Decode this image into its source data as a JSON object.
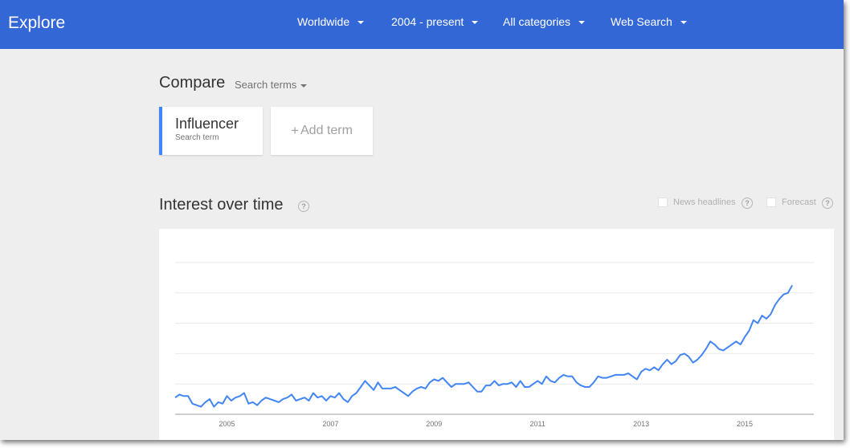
{
  "header": {
    "title": "Explore",
    "filters": [
      {
        "label": "Worldwide"
      },
      {
        "label": "2004 - present"
      },
      {
        "label": "All categories"
      },
      {
        "label": "Web Search"
      }
    ]
  },
  "compare": {
    "title": "Compare",
    "mode_label": "Search terms",
    "terms": [
      {
        "name": "Influencer",
        "type": "Search term",
        "color": "#4285f4"
      }
    ],
    "add_term_label": "Add term",
    "add_term_prefix": "+"
  },
  "interest_over_time": {
    "title": "Interest over time",
    "options": [
      {
        "label": "News headlines",
        "checked": false
      },
      {
        "label": "Forecast",
        "checked": false
      }
    ]
  },
  "colors": {
    "header_bg": "#3367d6",
    "line": "#4285f4",
    "page_bg": "#eeeeee"
  },
  "chart_data": {
    "type": "line",
    "title": "",
    "xlabel": "",
    "ylabel": "",
    "x_ticks": [
      "2005",
      "2007",
      "2009",
      "2011",
      "2013",
      "2015"
    ],
    "x_range": [
      "2004-01",
      "2016-05"
    ],
    "ylim": [
      0,
      100
    ],
    "grid": true,
    "series": [
      {
        "name": "Influencer",
        "color": "#4285f4",
        "start": "2004-01",
        "frequency": "monthly",
        "values": [
          11,
          13,
          12,
          12,
          7,
          6,
          5,
          8,
          10,
          5,
          8,
          7,
          12,
          9,
          11,
          12,
          14,
          7,
          8,
          6,
          9,
          11,
          10,
          9,
          8,
          10,
          11,
          13,
          9,
          10,
          11,
          9,
          14,
          11,
          12,
          9,
          12,
          11,
          14,
          10,
          8,
          12,
          14,
          18,
          22,
          19,
          16,
          21,
          17,
          17,
          17,
          18,
          16,
          14,
          12,
          15,
          17,
          18,
          17,
          21,
          23,
          22,
          24,
          21,
          18,
          20,
          20,
          20,
          21,
          18,
          15,
          15,
          19,
          19,
          22,
          19,
          20,
          20,
          21,
          18,
          22,
          18,
          18,
          20,
          22,
          20,
          25,
          22,
          21,
          24,
          26,
          25,
          25,
          21,
          19,
          18,
          18,
          21,
          25,
          24,
          24,
          25,
          26,
          26,
          26,
          27,
          25,
          23,
          28,
          30,
          29,
          31,
          29,
          33,
          36,
          33,
          35,
          39,
          40,
          38,
          34,
          36,
          39,
          43,
          48,
          46,
          43,
          42,
          44,
          46,
          48,
          46,
          51,
          55,
          62,
          60,
          65,
          63,
          66,
          72,
          76,
          79,
          80,
          85
        ]
      }
    ]
  }
}
